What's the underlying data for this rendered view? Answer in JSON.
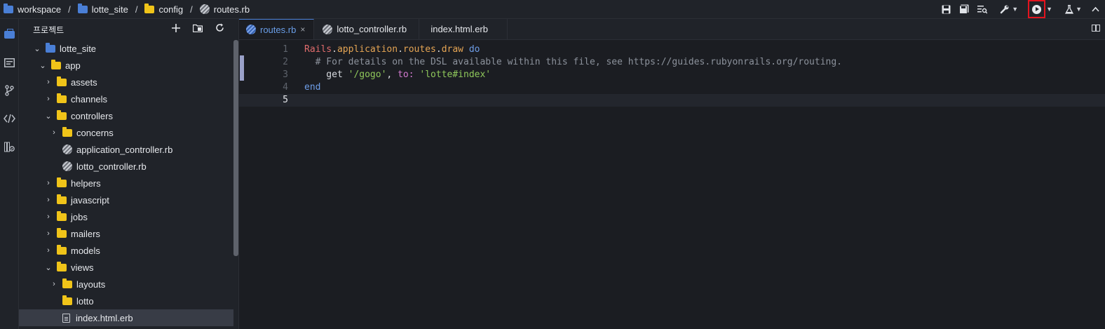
{
  "breadcrumb": {
    "items": [
      {
        "label": "workspace",
        "icon": "briefcase-icon"
      },
      {
        "label": "lotte_site",
        "icon": "folder-icon"
      },
      {
        "label": "config",
        "icon": "folder-icon"
      },
      {
        "label": "routes.rb",
        "icon": "ruby-file-icon"
      }
    ],
    "separator": "/"
  },
  "toolbar": {
    "buttons": [
      "save-icon",
      "save-all-icon",
      "find-file-icon",
      "tools-icon",
      "run-icon",
      "test-icon",
      "collapse-icon"
    ]
  },
  "activity_bar": [
    "project-icon",
    "outline-icon",
    "git-icon",
    "code-icon",
    "library-icon"
  ],
  "sidebar": {
    "title": "프로젝트",
    "actions": [
      "+",
      "new-folder",
      "refresh"
    ],
    "tree": [
      {
        "label": "lotte_site",
        "depth": 0,
        "type": "project",
        "expanded": true
      },
      {
        "label": "app",
        "depth": 1,
        "type": "folder-open",
        "expanded": true
      },
      {
        "label": "assets",
        "depth": 2,
        "type": "folder",
        "expanded": false
      },
      {
        "label": "channels",
        "depth": 2,
        "type": "folder",
        "expanded": false
      },
      {
        "label": "controllers",
        "depth": 2,
        "type": "folder-open",
        "expanded": true
      },
      {
        "label": "concerns",
        "depth": 3,
        "type": "folder",
        "expanded": false
      },
      {
        "label": "application_controller.rb",
        "depth": 3,
        "type": "ruby"
      },
      {
        "label": "lotto_controller.rb",
        "depth": 3,
        "type": "ruby"
      },
      {
        "label": "helpers",
        "depth": 2,
        "type": "folder",
        "expanded": false
      },
      {
        "label": "javascript",
        "depth": 2,
        "type": "folder",
        "expanded": false
      },
      {
        "label": "jobs",
        "depth": 2,
        "type": "folder",
        "expanded": false
      },
      {
        "label": "mailers",
        "depth": 2,
        "type": "folder",
        "expanded": false
      },
      {
        "label": "models",
        "depth": 2,
        "type": "folder",
        "expanded": false
      },
      {
        "label": "views",
        "depth": 2,
        "type": "folder-open",
        "expanded": true
      },
      {
        "label": "layouts",
        "depth": 3,
        "type": "folder",
        "expanded": false
      },
      {
        "label": "lotto",
        "depth": 3,
        "type": "folder-leaf"
      },
      {
        "label": "index.html.erb",
        "depth": 3,
        "type": "file",
        "selected": true
      }
    ]
  },
  "editor": {
    "tabs": [
      {
        "label": "routes.rb",
        "active": true,
        "close": "×"
      },
      {
        "label": "lotto_controller.rb",
        "active": false
      },
      {
        "label": "index.html.erb",
        "active": false
      }
    ],
    "current_line": 5,
    "lines": [
      {
        "n": "1",
        "tokens": [
          [
            "k-const",
            "Rails"
          ],
          [
            "k-plain",
            "."
          ],
          [
            "k-meth",
            "application"
          ],
          [
            "k-plain",
            "."
          ],
          [
            "k-meth",
            "routes"
          ],
          [
            "k-plain",
            "."
          ],
          [
            "k-meth",
            "draw"
          ],
          [
            "k-plain",
            " "
          ],
          [
            "k-kw",
            "do"
          ]
        ]
      },
      {
        "n": "2",
        "tokens": [
          [
            "k-com",
            "  # For details on the DSL available within this file, see https://guides.rubyonrails.org/routing."
          ]
        ]
      },
      {
        "n": "3",
        "tokens": [
          [
            "k-plain",
            "    get "
          ],
          [
            "k-str",
            "'/gogo'"
          ],
          [
            "k-plain",
            ", "
          ],
          [
            "k-sym",
            "to:"
          ],
          [
            "k-plain",
            " "
          ],
          [
            "k-str",
            "'lotte#index'"
          ]
        ]
      },
      {
        "n": "4",
        "tokens": [
          [
            "k-kw",
            "end"
          ]
        ]
      },
      {
        "n": "5",
        "tokens": []
      }
    ]
  },
  "colors": {
    "accent": "#4a7fd6",
    "folder": "#f0c419",
    "highlight_box": "#e3141f"
  }
}
